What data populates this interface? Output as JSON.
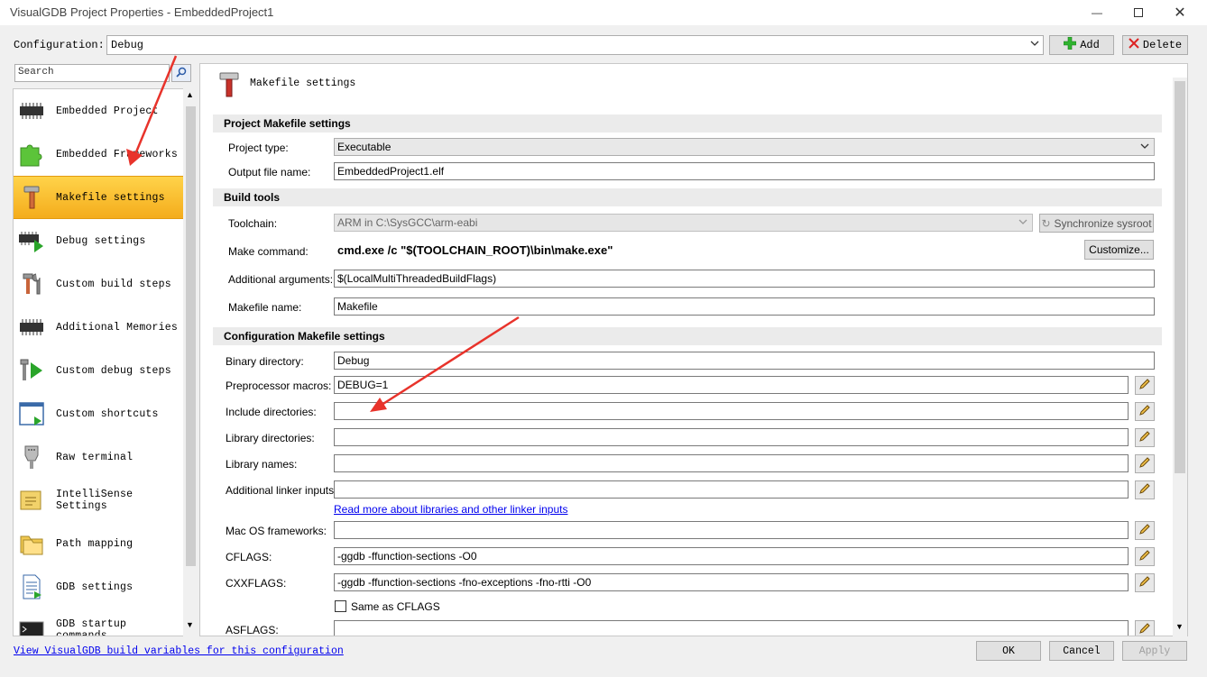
{
  "window": {
    "title": "VisualGDB Project Properties - EmbeddedProject1"
  },
  "config": {
    "label": "Configuration:",
    "value": "Debug",
    "add_label": "Add",
    "delete_label": "Delete"
  },
  "search": {
    "placeholder": "Search"
  },
  "nav": {
    "items": [
      {
        "label": "Embedded Project",
        "icon": "chip-icon"
      },
      {
        "label": "Embedded Frameworks",
        "icon": "puzzle-icon"
      },
      {
        "label": "Makefile settings",
        "icon": "hammer-icon",
        "selected": true
      },
      {
        "label": "Debug settings",
        "icon": "chip-play-icon"
      },
      {
        "label": "Custom build steps",
        "icon": "tools-icon"
      },
      {
        "label": "Additional Memories",
        "icon": "chip-icon"
      },
      {
        "label": "Custom debug steps",
        "icon": "wrench-play-icon"
      },
      {
        "label": "Custom shortcuts",
        "icon": "window-shortcut-icon"
      },
      {
        "label": "Raw terminal",
        "icon": "serial-connector-icon"
      },
      {
        "label": "IntelliSense Settings",
        "icon": "intellisense-icon"
      },
      {
        "label": "Path mapping",
        "icon": "folder-icon"
      },
      {
        "label": "GDB settings",
        "icon": "document-icon"
      },
      {
        "label": "GDB startup commands",
        "icon": "terminal-icon"
      }
    ]
  },
  "panel": {
    "title": "Makefile settings",
    "sections": {
      "project": "Project Makefile settings",
      "build_tools": "Build tools",
      "configuration": "Configuration Makefile settings"
    },
    "fields": {
      "project_type_label": "Project type:",
      "project_type_value": "Executable",
      "output_file_label": "Output file name:",
      "output_file_value": "EmbeddedProject1.elf",
      "toolchain_label": "Toolchain:",
      "toolchain_value": "ARM in C:\\SysGCC\\arm-eabi",
      "sync_sysroot_label": "Synchronize sysroot",
      "make_command_label": "Make command:",
      "make_command_value": "cmd.exe /c \"$(TOOLCHAIN_ROOT)\\bin\\make.exe\"",
      "customize_label": "Customize...",
      "additional_args_label": "Additional arguments:",
      "additional_args_value": "$(LocalMultiThreadedBuildFlags)",
      "makefile_name_label": "Makefile name:",
      "makefile_name_value": "Makefile",
      "binary_dir_label": "Binary directory:",
      "binary_dir_value": "Debug",
      "preproc_label": "Preprocessor macros:",
      "preproc_value": "DEBUG=1",
      "include_dirs_label": "Include directories:",
      "include_dirs_value": "",
      "library_dirs_label": "Library directories:",
      "library_dirs_value": "",
      "library_names_label": "Library names:",
      "library_names_value": "",
      "linker_inputs_label": "Additional linker inputs:",
      "linker_inputs_value": "",
      "read_more_link": "Read more about libraries and other linker inputs",
      "macos_label": "Mac OS frameworks:",
      "macos_value": "",
      "cflags_label": "CFLAGS:",
      "cflags_value": "-ggdb -ffunction-sections -O0",
      "cxxflags_label": "CXXFLAGS:",
      "cxxflags_value": "-ggdb -ffunction-sections -fno-exceptions -fno-rtti -O0",
      "same_as_cflags_label": "Same as CFLAGS",
      "same_as_cflags_checked": false,
      "asflags_label": "ASFLAGS:",
      "asflags_value": ""
    }
  },
  "bottom": {
    "link": "View VisualGDB build variables for this configuration",
    "ok_label": "OK",
    "cancel_label": "Cancel",
    "apply_label": "Apply"
  },
  "colors": {
    "selected_nav": "#f4ac1c",
    "annotation_arrow": "#e8332b",
    "link": "#0000ee"
  }
}
